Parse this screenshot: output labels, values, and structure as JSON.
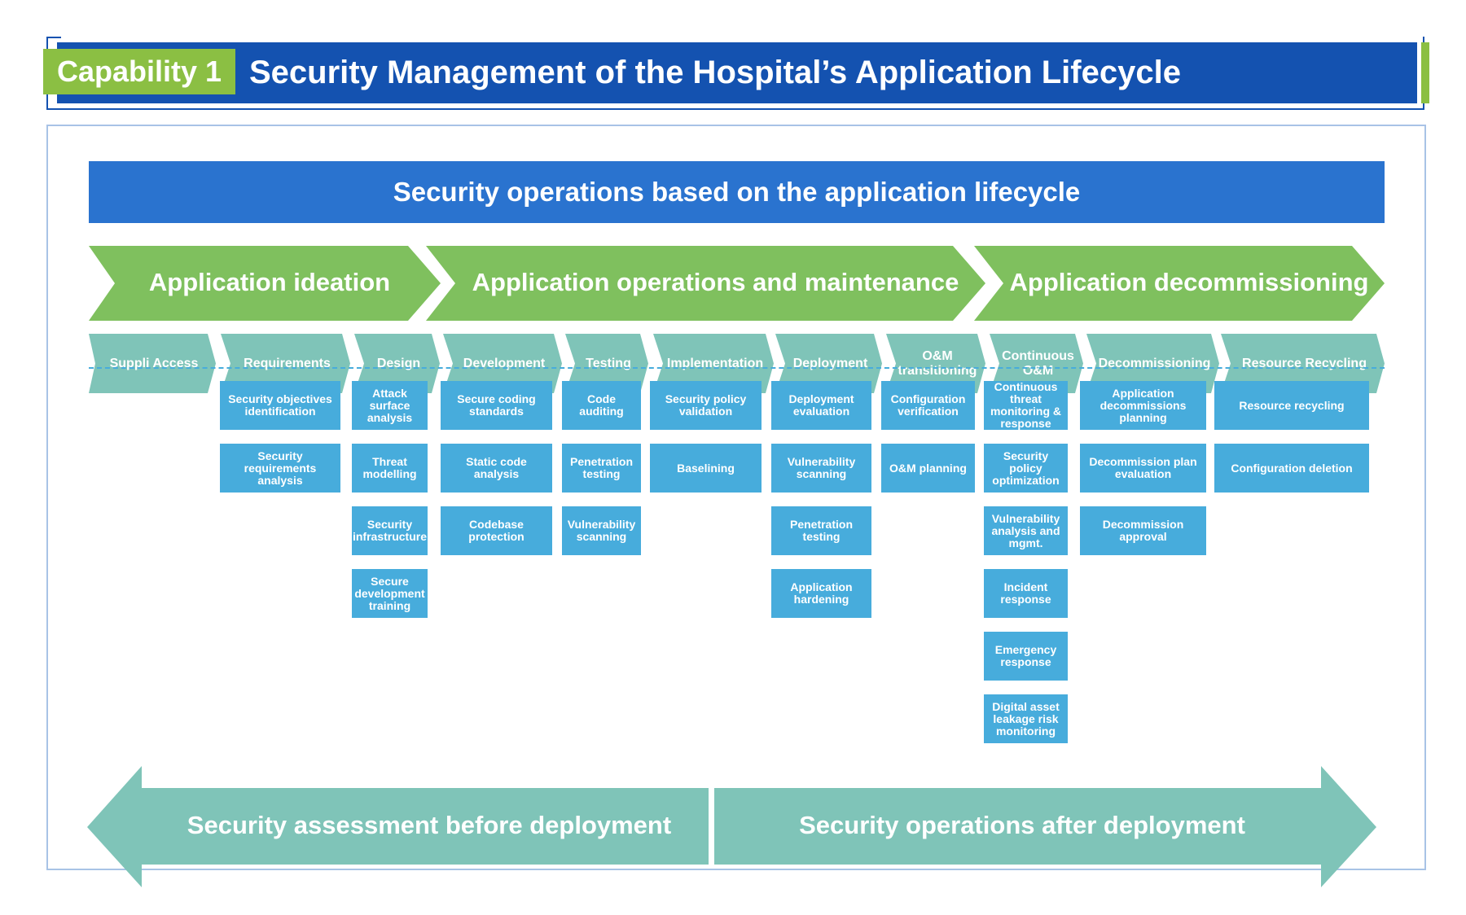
{
  "header": {
    "badge": "Capability 1",
    "title": "Security Management of the Hospital’s Application Lifecycle"
  },
  "banner": "Security operations based on the application lifecycle",
  "phases": [
    {
      "label": "Application ideation"
    },
    {
      "label": "Application operations and maintenance"
    },
    {
      "label": "Application decommissioning"
    }
  ],
  "stages": [
    {
      "label": "Suppli Access",
      "tasks": []
    },
    {
      "label": "Requirements",
      "tasks": [
        "Security objectives identification",
        "Security requirements analysis"
      ]
    },
    {
      "label": "Design",
      "tasks": [
        "Attack surface analysis",
        "Threat modelling",
        "Security infrastructure",
        "Secure development training"
      ]
    },
    {
      "label": "Development",
      "tasks": [
        "Secure coding standards",
        "Static code analysis",
        "Codebase protection"
      ]
    },
    {
      "label": "Testing",
      "tasks": [
        "Code auditing",
        "Penetration testing",
        "Vulnerability scanning"
      ]
    },
    {
      "label": "Implementation",
      "tasks": [
        "Security policy validation",
        "Baselining"
      ]
    },
    {
      "label": "Deployment",
      "tasks": [
        "Deployment evaluation",
        "Vulnerability scanning",
        "Penetration testing",
        "Application hardening"
      ]
    },
    {
      "label": "O&M transitioning",
      "tasks": [
        "Configuration verification",
        "O&M planning"
      ]
    },
    {
      "label": "Continuous O&M",
      "tasks": [
        "Continuous threat monitoring & response",
        "Security policy optimization",
        "Vulnerability analysis and mgmt.",
        "Incident response",
        "Emergency response",
        "Digital asset leakage risk monitoring"
      ]
    },
    {
      "label": "Decommissioning",
      "tasks": [
        "Application decommissions planning",
        "Decommission plan evaluation",
        "Decommission approval"
      ]
    },
    {
      "label": "Resource Recycling",
      "tasks": [
        "Resource recycling",
        "Configuration deletion"
      ]
    }
  ],
  "bottom": {
    "left": "Security assessment before deployment",
    "right": "Security operations after deployment"
  },
  "colors": {
    "title_blue": "#1452b0",
    "banner_blue": "#2a73cf",
    "phase_green": "#7fc05e",
    "badge_green": "#8bbf43",
    "stage_teal": "#7fc4b8",
    "task_blue": "#47acdc",
    "frame": "#a8c3e6"
  }
}
